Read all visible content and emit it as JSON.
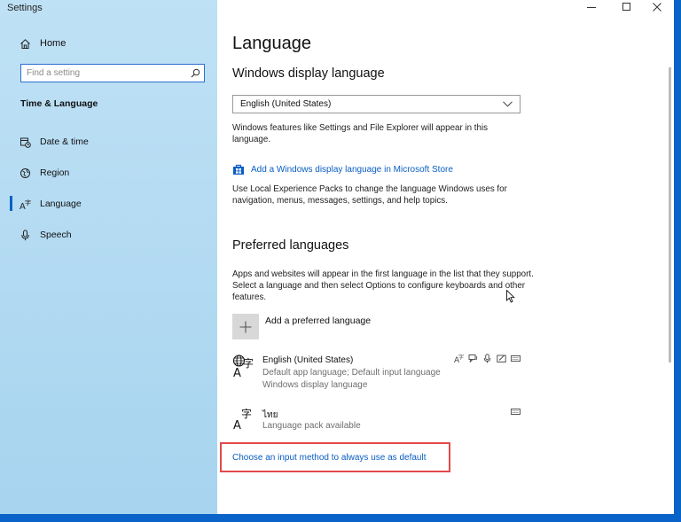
{
  "window": {
    "title": "Settings"
  },
  "sidebar": {
    "home_label": "Home",
    "search_placeholder": "Find a setting",
    "section_title": "Time & Language",
    "items": [
      {
        "label": "Date & time",
        "icon": "calendar-clock-icon"
      },
      {
        "label": "Region",
        "icon": "globe-region-icon"
      },
      {
        "label": "Language",
        "icon": "language-icon",
        "selected": true
      },
      {
        "label": "Speech",
        "icon": "microphone-icon"
      }
    ]
  },
  "main": {
    "page_title": "Language",
    "display_language": {
      "heading": "Windows display language",
      "selected": "English (United States)",
      "description": "Windows features like Settings and File Explorer will appear in this language.",
      "store_link": "Add a Windows display language in Microsoft Store",
      "packs_description": "Use Local Experience Packs to change the language Windows uses for navigation, menus, messages, settings, and help topics."
    },
    "preferred": {
      "heading": "Preferred languages",
      "description": "Apps and websites will appear in the first language in the list that they support. Select a language and then select Options to configure keyboards and other features.",
      "add_label": "Add a preferred language",
      "languages": [
        {
          "name": "English (United States)",
          "details": [
            "Default app language; Default input language",
            "Windows display language"
          ]
        },
        {
          "name": "ไทย",
          "details": [
            "Language pack available"
          ]
        }
      ]
    },
    "input_method_link": "Choose an input method to always use as default"
  },
  "colors": {
    "accent": "#0a5ec4",
    "sidebar_bg": "#b3daf2",
    "highlight": "#e24a4a"
  }
}
